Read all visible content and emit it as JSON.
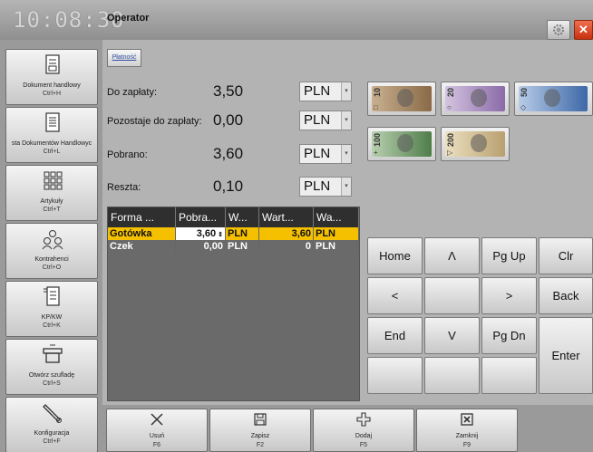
{
  "header": {
    "clock": "10:08:30",
    "title": "Operator"
  },
  "sidebar": {
    "items": [
      {
        "label": "Dokument handlowy",
        "shortcut": "Ctrl+H",
        "icon": "document-icon"
      },
      {
        "label": "sta Dokumentów Handlowyc",
        "shortcut": "Ctrl+L",
        "icon": "document-list-icon"
      },
      {
        "label": "Artykuły",
        "shortcut": "Ctrl+T",
        "icon": "items-grid-icon"
      },
      {
        "label": "Kontrahenci",
        "shortcut": "Ctrl+O",
        "icon": "contacts-icon"
      },
      {
        "label": "KP/KW",
        "shortcut": "Ctrl+K",
        "icon": "cash-document-icon"
      },
      {
        "label": "Otwórz szufladę",
        "shortcut": "Ctrl+S",
        "icon": "cash-drawer-icon"
      },
      {
        "label": "Konfiguracja",
        "shortcut": "Ctrl+F",
        "icon": "wrench-icon"
      }
    ]
  },
  "main": {
    "tab": "Płatność",
    "rows": [
      {
        "label": "Do zapłaty:",
        "value": "3,50",
        "currency": "PLN"
      },
      {
        "label": "Pozostaje do zapłaty:",
        "value": "0,00",
        "currency": "PLN"
      },
      {
        "label": "Pobrano:",
        "value": "3,60",
        "currency": "PLN"
      },
      {
        "label": "Reszta:",
        "value": "0,10",
        "currency": "PLN"
      }
    ],
    "table": {
      "headers": [
        "Forma ...",
        "Pobra...",
        "W...",
        "Wart...",
        "Wa..."
      ],
      "rows": [
        [
          "Gotówka",
          "3,60",
          "PLN",
          "3,60",
          "PLN"
        ],
        [
          "Czek",
          "0,00",
          "PLN",
          "0",
          "PLN"
        ]
      ]
    }
  },
  "banknotes": [
    {
      "denomination": "10",
      "symbol": "□",
      "color": "#9c7a54"
    },
    {
      "denomination": "20",
      "symbol": "○",
      "color": "#8a6aa8"
    },
    {
      "denomination": "50",
      "symbol": "◇",
      "color": "#3e68a8"
    },
    {
      "denomination": "100",
      "symbol": "+",
      "color": "#4f7d4a"
    },
    {
      "denomination": "200",
      "symbol": "▷",
      "color": "#b8a070"
    }
  ],
  "keypad": {
    "home": "Home",
    "up": "Λ",
    "pgup": "Pg Up",
    "clr": "Clr",
    "left": "<",
    "right": ">",
    "back": "Back",
    "end": "End",
    "down": "V",
    "pgdn": "Pg Dn",
    "enter": "Enter"
  },
  "toolbar": [
    {
      "label": "Usuń",
      "shortcut": "F6",
      "icon": "delete-icon"
    },
    {
      "label": "Zapisz",
      "shortcut": "F2",
      "icon": "save-icon"
    },
    {
      "label": "Dodaj",
      "shortcut": "F5",
      "icon": "add-icon"
    },
    {
      "label": "Zamknij",
      "shortcut": "F9",
      "icon": "close-icon"
    }
  ],
  "colors": {
    "selected_row": "#f5c000",
    "close_button": "#d84020"
  }
}
